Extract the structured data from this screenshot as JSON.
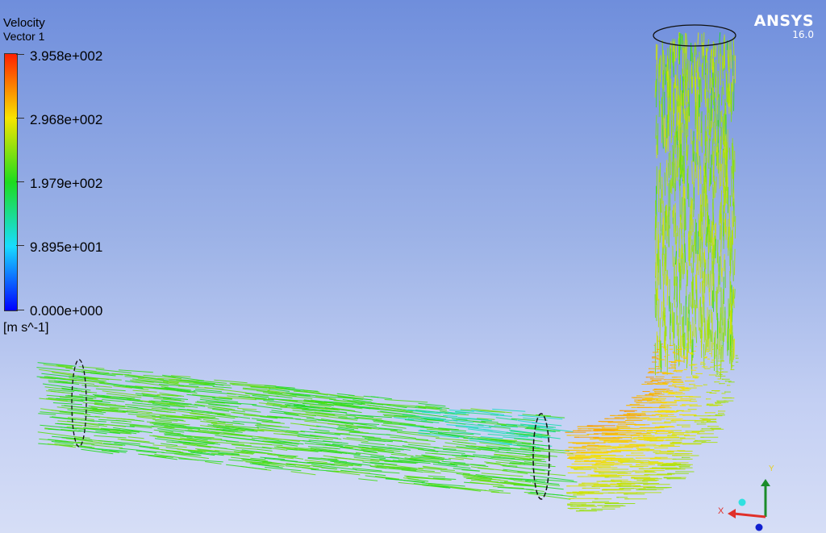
{
  "legend": {
    "title": "Velocity",
    "subtitle": "Vector 1",
    "labels": [
      "3.958e+002",
      "2.968e+002",
      "1.979e+002",
      "9.895e+001",
      "0.000e+000"
    ],
    "unit": "[m s^-1]",
    "colors": [
      "#ff2000",
      "#f7e400",
      "#1ddc1f",
      "#19dcff",
      "#0000ff"
    ]
  },
  "brand": {
    "name": "ANSYS",
    "version": "16.0"
  },
  "axes": {
    "x_label": "X",
    "y_label": "Y",
    "x_color": "#e0302a",
    "y_color": "#1a8c2a",
    "z_color": "#1020d0"
  }
}
